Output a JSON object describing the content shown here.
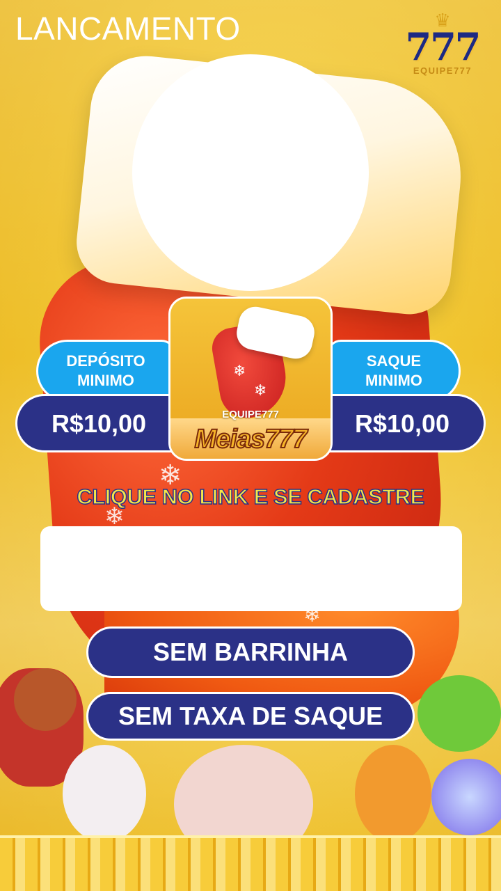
{
  "header": {
    "title": "LANCAMENTO"
  },
  "logo": {
    "number": "777",
    "brand": "EQUIPE777"
  },
  "deposit": {
    "label_line1": "DEPÓSITO",
    "label_line2": "MINIMO",
    "value": "R$10,00"
  },
  "withdraw": {
    "label_line1": "SAQUE",
    "label_line2": "MINIMO",
    "value": "R$10,00"
  },
  "app": {
    "team": "EQUIPE777",
    "name": "Meias777"
  },
  "cta": {
    "text": "CLIQUE NO LINK E SE CADASTRE"
  },
  "buttons": {
    "no_bar": "SEM BARRINHA",
    "no_fee": "SEM TAXA DE SAQUE"
  },
  "colors": {
    "navy": "#2b3187",
    "blue": "#1aa6ee",
    "gold": "#f1c52f",
    "red": "#e43a17"
  }
}
